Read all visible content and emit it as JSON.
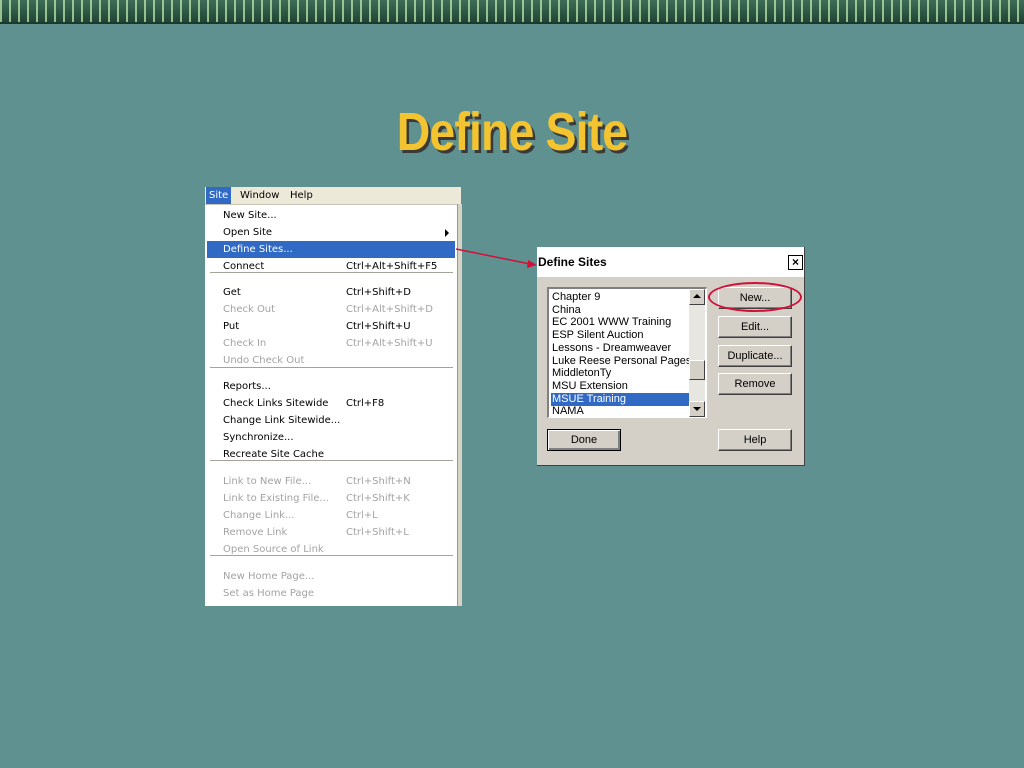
{
  "slide": {
    "title": "Define Site"
  },
  "menubar": {
    "items": [
      "Site",
      "Window",
      "Help"
    ],
    "active": "Site"
  },
  "site_menu": {
    "items": [
      {
        "label": "New Site...",
        "shortcut": "",
        "enabled": true
      },
      {
        "label": "Open Site",
        "shortcut": "",
        "enabled": true,
        "submenu": true
      },
      {
        "label": "Define Sites...",
        "shortcut": "",
        "enabled": true,
        "highlighted": true
      },
      {
        "label": "Connect",
        "shortcut": "Ctrl+Alt+Shift+F5",
        "enabled": true
      },
      {
        "label": "Get",
        "shortcut": "Ctrl+Shift+D",
        "enabled": true
      },
      {
        "label": "Check Out",
        "shortcut": "Ctrl+Alt+Shift+D",
        "enabled": false
      },
      {
        "label": "Put",
        "shortcut": "Ctrl+Shift+U",
        "enabled": true
      },
      {
        "label": "Check In",
        "shortcut": "Ctrl+Alt+Shift+U",
        "enabled": false
      },
      {
        "label": "Undo Check Out",
        "shortcut": "",
        "enabled": false
      },
      {
        "label": "Reports...",
        "shortcut": "",
        "enabled": true
      },
      {
        "label": "Check Links Sitewide",
        "shortcut": "Ctrl+F8",
        "enabled": true
      },
      {
        "label": "Change Link Sitewide...",
        "shortcut": "",
        "enabled": true
      },
      {
        "label": "Synchronize...",
        "shortcut": "",
        "enabled": true
      },
      {
        "label": "Recreate Site Cache",
        "shortcut": "",
        "enabled": true
      },
      {
        "label": "Link to New File...",
        "shortcut": "Ctrl+Shift+N",
        "enabled": false
      },
      {
        "label": "Link to Existing File...",
        "shortcut": "Ctrl+Shift+K",
        "enabled": false
      },
      {
        "label": "Change Link...",
        "shortcut": "Ctrl+L",
        "enabled": false
      },
      {
        "label": "Remove Link",
        "shortcut": "Ctrl+Shift+L",
        "enabled": false
      },
      {
        "label": "Open Source of Link",
        "shortcut": "",
        "enabled": false
      },
      {
        "label": "New Home Page...",
        "shortcut": "",
        "enabled": false
      },
      {
        "label": "Set as Home Page",
        "shortcut": "",
        "enabled": false
      }
    ]
  },
  "dialog": {
    "title": "Define Sites",
    "close_label": "×",
    "sites": [
      "Chapter 9",
      "China",
      "EC 2001 WWW Training",
      "ESP Silent Auction",
      "Lessons - Dreamweaver",
      "Luke Reese Personal Pages",
      "MiddletonTy",
      "MSU Extension",
      "MSUE Training",
      "NAMA"
    ],
    "selected_site": "MSUE Training",
    "buttons": {
      "new": "New...",
      "edit": "Edit...",
      "duplicate": "Duplicate...",
      "remove": "Remove",
      "done": "Done",
      "help": "Help"
    }
  },
  "colors": {
    "background": "#5f9191",
    "title": "#f4c430",
    "highlight": "#316ac5",
    "callout": "#d0103a"
  }
}
